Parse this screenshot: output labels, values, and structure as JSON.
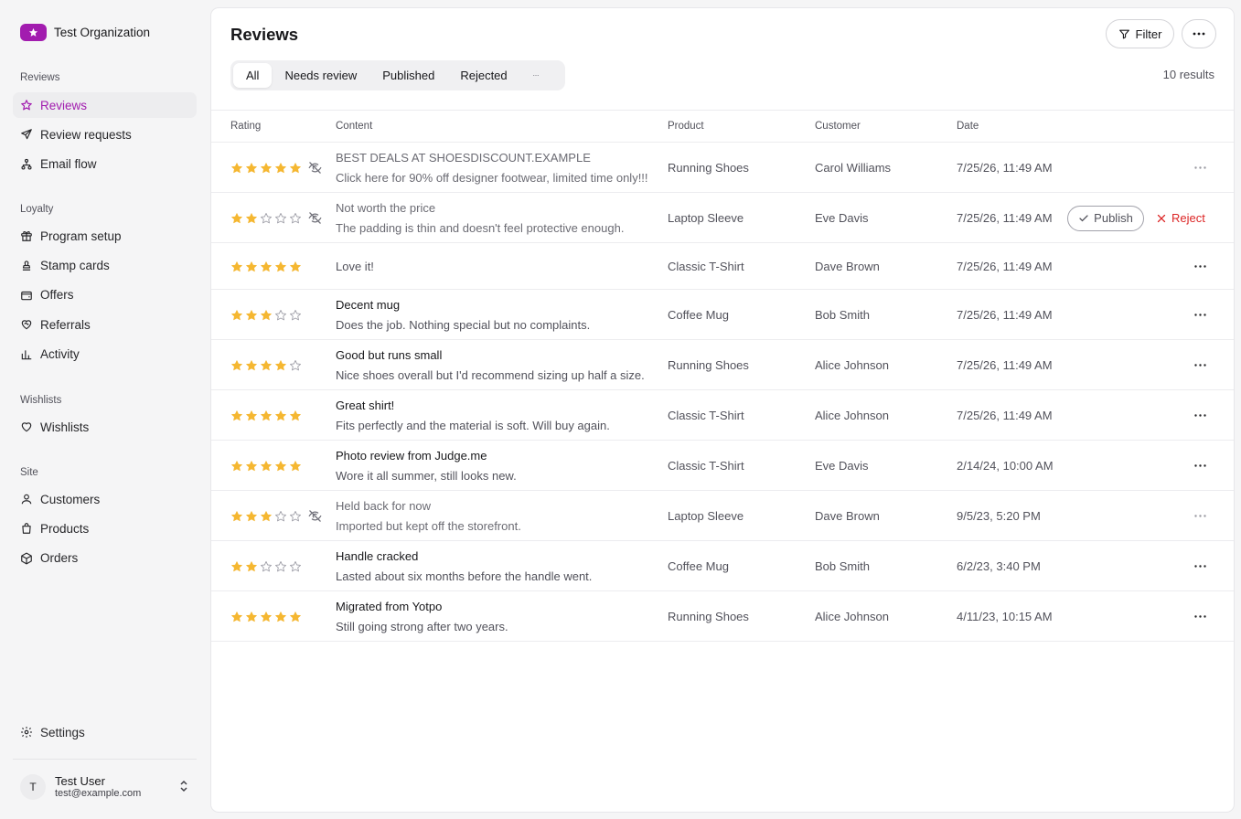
{
  "org": {
    "name": "Test Organization",
    "badge_icon": "star-icon",
    "badge_color": "#a21caf"
  },
  "sidebar": {
    "groups": [
      {
        "title": "Reviews",
        "items": [
          {
            "label": "Reviews",
            "icon": "star-icon",
            "active": true
          },
          {
            "label": "Review requests",
            "icon": "send-icon"
          },
          {
            "label": "Email flow",
            "icon": "flow-icon"
          }
        ]
      },
      {
        "title": "Loyalty",
        "items": [
          {
            "label": "Program setup",
            "icon": "gift-icon"
          },
          {
            "label": "Stamp cards",
            "icon": "stamp-icon"
          },
          {
            "label": "Offers",
            "icon": "wallet-icon"
          },
          {
            "label": "Referrals",
            "icon": "heart-handshake-icon"
          },
          {
            "label": "Activity",
            "icon": "chart-icon"
          }
        ]
      },
      {
        "title": "Wishlists",
        "items": [
          {
            "label": "Wishlists",
            "icon": "heart-icon"
          }
        ]
      },
      {
        "title": "Site",
        "items": [
          {
            "label": "Customers",
            "icon": "user-icon"
          },
          {
            "label": "Products",
            "icon": "bag-icon"
          },
          {
            "label": "Orders",
            "icon": "package-icon"
          }
        ]
      }
    ],
    "settings_label": "Settings",
    "user": {
      "initial": "T",
      "name": "Test User",
      "email": "test@example.com"
    }
  },
  "main": {
    "title": "Reviews",
    "filter_label": "Filter",
    "tabs": [
      "All",
      "Needs review",
      "Published",
      "Rejected"
    ],
    "results": "10 results",
    "columns": {
      "rating": "Rating",
      "content": "Content",
      "product": "Product",
      "customer": "Customer",
      "date": "Date"
    },
    "publish_label": "Publish",
    "reject_label": "Reject",
    "rows": [
      {
        "rating": 5,
        "hidden": true,
        "dim": true,
        "title": "BEST DEALS AT SHOESDISCOUNT.EXAMPLE",
        "body": "Click here for 90% off designer footwear, limited time only!!!",
        "product": "Running Shoes",
        "customer": "Carol Williams",
        "date": "7/25/26, 11:49 AM",
        "actions": "more"
      },
      {
        "rating": 2,
        "hidden": true,
        "dim": true,
        "title": "Not worth the price",
        "body": "The padding is thin and doesn't feel protective enough.",
        "product": "Laptop Sleeve",
        "customer": "Eve Davis",
        "date": "7/25/26, 11:49 AM",
        "actions": "moderate"
      },
      {
        "rating": 5,
        "hidden": false,
        "dim": false,
        "title": "",
        "body": "Love it!",
        "product": "Classic T-Shirt",
        "customer": "Dave Brown",
        "date": "7/25/26, 11:49 AM",
        "actions": "more"
      },
      {
        "rating": 3,
        "hidden": false,
        "dim": false,
        "title": "Decent mug",
        "body": "Does the job. Nothing special but no complaints.",
        "product": "Coffee Mug",
        "customer": "Bob Smith",
        "date": "7/25/26, 11:49 AM",
        "actions": "more"
      },
      {
        "rating": 4,
        "hidden": false,
        "dim": false,
        "title": "Good but runs small",
        "body": "Nice shoes overall but I'd recommend sizing up half a size.",
        "product": "Running Shoes",
        "customer": "Alice Johnson",
        "date": "7/25/26, 11:49 AM",
        "actions": "more"
      },
      {
        "rating": 5,
        "hidden": false,
        "dim": false,
        "title": "Great shirt!",
        "body": "Fits perfectly and the material is soft. Will buy again.",
        "product": "Classic T-Shirt",
        "customer": "Alice Johnson",
        "date": "7/25/26, 11:49 AM",
        "actions": "more"
      },
      {
        "rating": 5,
        "hidden": false,
        "dim": false,
        "title": "Photo review from Judge.me",
        "body": "Wore it all summer, still looks new.",
        "product": "Classic T-Shirt",
        "customer": "Eve Davis",
        "date": "2/14/24, 10:00 AM",
        "actions": "more"
      },
      {
        "rating": 3,
        "hidden": true,
        "dim": true,
        "title": "Held back for now",
        "body": "Imported but kept off the storefront.",
        "product": "Laptop Sleeve",
        "customer": "Dave Brown",
        "date": "9/5/23, 5:20 PM",
        "actions": "more"
      },
      {
        "rating": 2,
        "hidden": false,
        "dim": false,
        "title": "Handle cracked",
        "body": "Lasted about six months before the handle went.",
        "product": "Coffee Mug",
        "customer": "Bob Smith",
        "date": "6/2/23, 3:40 PM",
        "actions": "more"
      },
      {
        "rating": 5,
        "hidden": false,
        "dim": false,
        "title": "Migrated from Yotpo",
        "body": "Still going strong after two years.",
        "product": "Running Shoes",
        "customer": "Alice Johnson",
        "date": "4/11/23, 10:15 AM",
        "actions": "more"
      }
    ]
  },
  "colors": {
    "accent": "#a21caf",
    "star_filled": "#f5b731",
    "star_empty": "#a1a1aa",
    "reject": "#dc2626"
  }
}
